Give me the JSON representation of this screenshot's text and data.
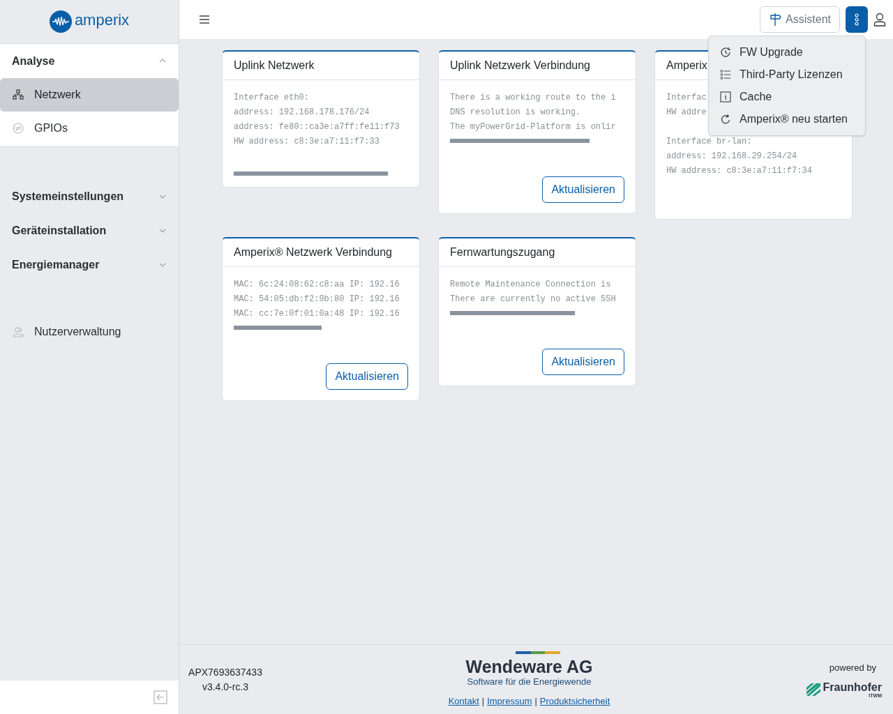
{
  "logo": {
    "text": "amperix"
  },
  "sidebar": {
    "sections": [
      {
        "kind": "group",
        "label": "Analyse",
        "expanded": true,
        "items": [
          {
            "label": "Netzwerk",
            "selected": true
          },
          {
            "label": "GPIOs",
            "selected": false
          }
        ]
      },
      {
        "kind": "group",
        "label": "Systemeinstellungen",
        "expanded": false
      },
      {
        "kind": "group",
        "label": "Geräteinstallation",
        "expanded": false
      },
      {
        "kind": "group",
        "label": "Energiemanager",
        "expanded": false
      },
      {
        "kind": "link",
        "label": "Nutzerverwaltung",
        "selected": false
      }
    ]
  },
  "header": {
    "assistant_button": {
      "label": "Assistent"
    },
    "more_menu": {
      "open": true,
      "items": [
        {
          "label": "FW Upgrade"
        },
        {
          "label": "Third-Party Lizenzen"
        },
        {
          "label": "Cache"
        },
        {
          "label": "Amperix® neu starten"
        }
      ]
    }
  },
  "cards": [
    {
      "title": "Uplink Netzwerk",
      "blocks": [
        [
          "Interface eth0:",
          "address: 192.168.178.176/24",
          "address: fe80::ca3e:a7ff:fe11:f73",
          "HW address: c8:3e:a7:11:f7:33"
        ]
      ]
    },
    {
      "title": "Uplink Netzwerk Verbindung",
      "blocks": [
        [
          "There is a working route to the i",
          "DNS resolution is working.",
          "The myPowerGrid-Platform is onlir"
        ]
      ],
      "button": "Aktualisieren"
    },
    {
      "title": "Amperix",
      "blocks": [
        [
          "Interfac",
          "HW addre"
        ],
        [
          "Interface br-lan:",
          "address: 192.168.29.254/24",
          "HW address: c8:3e:a7:11:f7:34"
        ]
      ]
    },
    {
      "title": "Amperix® Netzwerk Verbindung",
      "blocks": [
        [
          "MAC: 6c:24:08:62:c8:aa IP: 192.16",
          "MAC: 54:05:db:f2:9b:80 IP: 192.16",
          "MAC: cc:7e:0f:01:0a:48 IP: 192.16"
        ]
      ],
      "button": "Aktualisieren"
    },
    {
      "title": "Fernwartungszugang",
      "blocks": [
        [
          "Remote Maintenance Connection is",
          "There are currently no active SSH"
        ]
      ],
      "button": "Aktualisieren"
    }
  ],
  "footer": {
    "device_id": "APX7693637433",
    "version": "v3.4.0-rc.3",
    "company": {
      "name": "Wendeware AG",
      "tagline": "Software für die Energiewende"
    },
    "links": [
      {
        "kind": "link",
        "text": "Kontakt"
      },
      {
        "kind": "separator",
        "text": "|"
      },
      {
        "kind": "link",
        "text": "Impressum"
      },
      {
        "kind": "separator",
        "text": "|"
      },
      {
        "kind": "link",
        "text": "Produktsicherheit"
      }
    ],
    "powered_by": "powered by",
    "partner": {
      "name": "Fraunhofer",
      "unit": "ITWM"
    }
  }
}
